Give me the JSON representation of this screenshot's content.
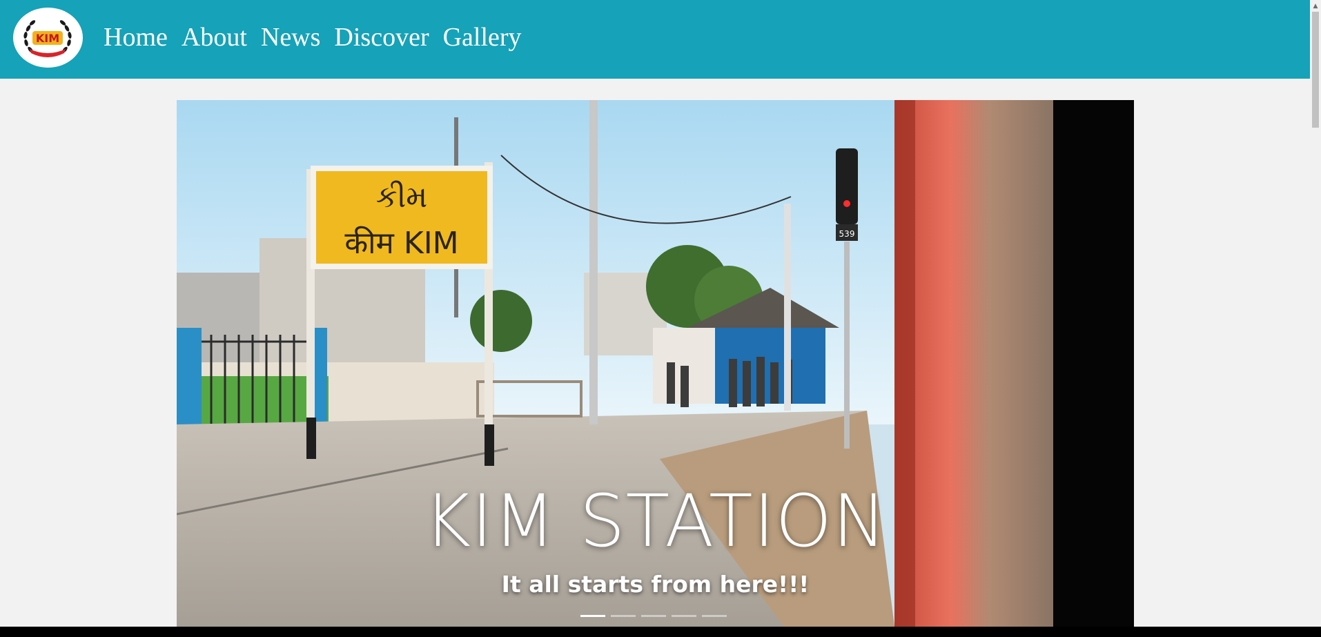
{
  "brand": {
    "logo_icon": "kim-emblem-logo",
    "logo_text": "KIM"
  },
  "nav": {
    "items": [
      {
        "label": "Home"
      },
      {
        "label": "About"
      },
      {
        "label": "News"
      },
      {
        "label": "Discover"
      },
      {
        "label": "Gallery"
      }
    ]
  },
  "carousel": {
    "title": "KIM STATION",
    "subtitle": "It all starts from here!!!",
    "slide_count": 5,
    "active_slide": 1,
    "sign_text_line1": "કીમ",
    "sign_text_line2": "कीम  KIM",
    "signal_number": "539"
  },
  "colors": {
    "navbar": "#16a2b8",
    "page_bg": "#f2f2f2"
  }
}
